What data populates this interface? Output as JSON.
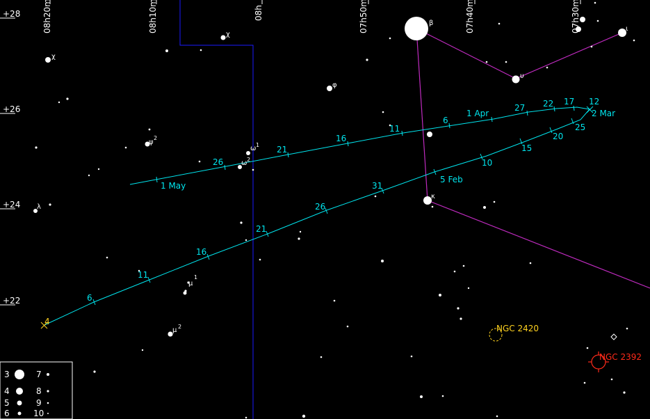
{
  "ra_labels": [
    "08h20m",
    "08h10m",
    "08h",
    "07h50m",
    "07h40m",
    "07h30m"
  ],
  "dec_labels": [
    "+28",
    "+26",
    "+24",
    "+22"
  ],
  "greek_labels": {
    "chi_left": "χ",
    "chi_mid": "χ",
    "beta": "β",
    "iota": "ι",
    "upsilon": "υ",
    "phi": "φ",
    "psi": "ψ",
    "psi_sup": "2",
    "omega1": "ω",
    "omega1_sup": "1",
    "omega2": "ω",
    "omega2_sup": "2",
    "lambda": "λ",
    "kappa": "κ",
    "mu1": "μ",
    "mu1_sup": "1",
    "mu2": "μ",
    "mu2_sup": "2"
  },
  "track_upper_labels": [
    "1 May",
    "26",
    "21",
    "16",
    "11",
    "6",
    "1 Apr",
    "27",
    "22",
    "17",
    "12",
    "2 Mar"
  ],
  "track_lower_labels": [
    "4",
    "6",
    "11",
    "16",
    "21",
    "26",
    "31",
    "5 Feb",
    "10",
    "15",
    "20",
    "25"
  ],
  "deep_sky": {
    "ngc2420": "NGC 2420",
    "ngc2392": "NGC 2392"
  },
  "legend": {
    "left": [
      "3",
      "4",
      "5",
      "6"
    ],
    "right": [
      "7",
      "8",
      "9",
      "10"
    ]
  },
  "colors": {
    "background": "#000000",
    "track": "#00e5ee",
    "constellation_lines": "#c02bc0",
    "boundary": "#1a1aff",
    "ngc2420": "#ffd21f",
    "ngc2392": "#ff2a1a"
  }
}
